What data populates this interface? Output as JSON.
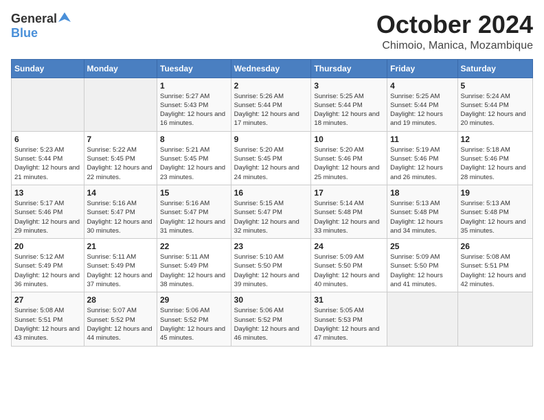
{
  "header": {
    "logo_general": "General",
    "logo_blue": "Blue",
    "main_title": "October 2024",
    "subtitle": "Chimoio, Manica, Mozambique"
  },
  "weekdays": [
    "Sunday",
    "Monday",
    "Tuesday",
    "Wednesday",
    "Thursday",
    "Friday",
    "Saturday"
  ],
  "weeks": [
    [
      {
        "day": "",
        "sunrise": "",
        "sunset": "",
        "daylight": ""
      },
      {
        "day": "",
        "sunrise": "",
        "sunset": "",
        "daylight": ""
      },
      {
        "day": "1",
        "sunrise": "Sunrise: 5:27 AM",
        "sunset": "Sunset: 5:43 PM",
        "daylight": "Daylight: 12 hours and 16 minutes."
      },
      {
        "day": "2",
        "sunrise": "Sunrise: 5:26 AM",
        "sunset": "Sunset: 5:44 PM",
        "daylight": "Daylight: 12 hours and 17 minutes."
      },
      {
        "day": "3",
        "sunrise": "Sunrise: 5:25 AM",
        "sunset": "Sunset: 5:44 PM",
        "daylight": "Daylight: 12 hours and 18 minutes."
      },
      {
        "day": "4",
        "sunrise": "Sunrise: 5:25 AM",
        "sunset": "Sunset: 5:44 PM",
        "daylight": "Daylight: 12 hours and 19 minutes."
      },
      {
        "day": "5",
        "sunrise": "Sunrise: 5:24 AM",
        "sunset": "Sunset: 5:44 PM",
        "daylight": "Daylight: 12 hours and 20 minutes."
      }
    ],
    [
      {
        "day": "6",
        "sunrise": "Sunrise: 5:23 AM",
        "sunset": "Sunset: 5:44 PM",
        "daylight": "Daylight: 12 hours and 21 minutes."
      },
      {
        "day": "7",
        "sunrise": "Sunrise: 5:22 AM",
        "sunset": "Sunset: 5:45 PM",
        "daylight": "Daylight: 12 hours and 22 minutes."
      },
      {
        "day": "8",
        "sunrise": "Sunrise: 5:21 AM",
        "sunset": "Sunset: 5:45 PM",
        "daylight": "Daylight: 12 hours and 23 minutes."
      },
      {
        "day": "9",
        "sunrise": "Sunrise: 5:20 AM",
        "sunset": "Sunset: 5:45 PM",
        "daylight": "Daylight: 12 hours and 24 minutes."
      },
      {
        "day": "10",
        "sunrise": "Sunrise: 5:20 AM",
        "sunset": "Sunset: 5:46 PM",
        "daylight": "Daylight: 12 hours and 25 minutes."
      },
      {
        "day": "11",
        "sunrise": "Sunrise: 5:19 AM",
        "sunset": "Sunset: 5:46 PM",
        "daylight": "Daylight: 12 hours and 26 minutes."
      },
      {
        "day": "12",
        "sunrise": "Sunrise: 5:18 AM",
        "sunset": "Sunset: 5:46 PM",
        "daylight": "Daylight: 12 hours and 28 minutes."
      }
    ],
    [
      {
        "day": "13",
        "sunrise": "Sunrise: 5:17 AM",
        "sunset": "Sunset: 5:46 PM",
        "daylight": "Daylight: 12 hours and 29 minutes."
      },
      {
        "day": "14",
        "sunrise": "Sunrise: 5:16 AM",
        "sunset": "Sunset: 5:47 PM",
        "daylight": "Daylight: 12 hours and 30 minutes."
      },
      {
        "day": "15",
        "sunrise": "Sunrise: 5:16 AM",
        "sunset": "Sunset: 5:47 PM",
        "daylight": "Daylight: 12 hours and 31 minutes."
      },
      {
        "day": "16",
        "sunrise": "Sunrise: 5:15 AM",
        "sunset": "Sunset: 5:47 PM",
        "daylight": "Daylight: 12 hours and 32 minutes."
      },
      {
        "day": "17",
        "sunrise": "Sunrise: 5:14 AM",
        "sunset": "Sunset: 5:48 PM",
        "daylight": "Daylight: 12 hours and 33 minutes."
      },
      {
        "day": "18",
        "sunrise": "Sunrise: 5:13 AM",
        "sunset": "Sunset: 5:48 PM",
        "daylight": "Daylight: 12 hours and 34 minutes."
      },
      {
        "day": "19",
        "sunrise": "Sunrise: 5:13 AM",
        "sunset": "Sunset: 5:48 PM",
        "daylight": "Daylight: 12 hours and 35 minutes."
      }
    ],
    [
      {
        "day": "20",
        "sunrise": "Sunrise: 5:12 AM",
        "sunset": "Sunset: 5:49 PM",
        "daylight": "Daylight: 12 hours and 36 minutes."
      },
      {
        "day": "21",
        "sunrise": "Sunrise: 5:11 AM",
        "sunset": "Sunset: 5:49 PM",
        "daylight": "Daylight: 12 hours and 37 minutes."
      },
      {
        "day": "22",
        "sunrise": "Sunrise: 5:11 AM",
        "sunset": "Sunset: 5:49 PM",
        "daylight": "Daylight: 12 hours and 38 minutes."
      },
      {
        "day": "23",
        "sunrise": "Sunrise: 5:10 AM",
        "sunset": "Sunset: 5:50 PM",
        "daylight": "Daylight: 12 hours and 39 minutes."
      },
      {
        "day": "24",
        "sunrise": "Sunrise: 5:09 AM",
        "sunset": "Sunset: 5:50 PM",
        "daylight": "Daylight: 12 hours and 40 minutes."
      },
      {
        "day": "25",
        "sunrise": "Sunrise: 5:09 AM",
        "sunset": "Sunset: 5:50 PM",
        "daylight": "Daylight: 12 hours and 41 minutes."
      },
      {
        "day": "26",
        "sunrise": "Sunrise: 5:08 AM",
        "sunset": "Sunset: 5:51 PM",
        "daylight": "Daylight: 12 hours and 42 minutes."
      }
    ],
    [
      {
        "day": "27",
        "sunrise": "Sunrise: 5:08 AM",
        "sunset": "Sunset: 5:51 PM",
        "daylight": "Daylight: 12 hours and 43 minutes."
      },
      {
        "day": "28",
        "sunrise": "Sunrise: 5:07 AM",
        "sunset": "Sunset: 5:52 PM",
        "daylight": "Daylight: 12 hours and 44 minutes."
      },
      {
        "day": "29",
        "sunrise": "Sunrise: 5:06 AM",
        "sunset": "Sunset: 5:52 PM",
        "daylight": "Daylight: 12 hours and 45 minutes."
      },
      {
        "day": "30",
        "sunrise": "Sunrise: 5:06 AM",
        "sunset": "Sunset: 5:52 PM",
        "daylight": "Daylight: 12 hours and 46 minutes."
      },
      {
        "day": "31",
        "sunrise": "Sunrise: 5:05 AM",
        "sunset": "Sunset: 5:53 PM",
        "daylight": "Daylight: 12 hours and 47 minutes."
      },
      {
        "day": "",
        "sunrise": "",
        "sunset": "",
        "daylight": ""
      },
      {
        "day": "",
        "sunrise": "",
        "sunset": "",
        "daylight": ""
      }
    ]
  ]
}
